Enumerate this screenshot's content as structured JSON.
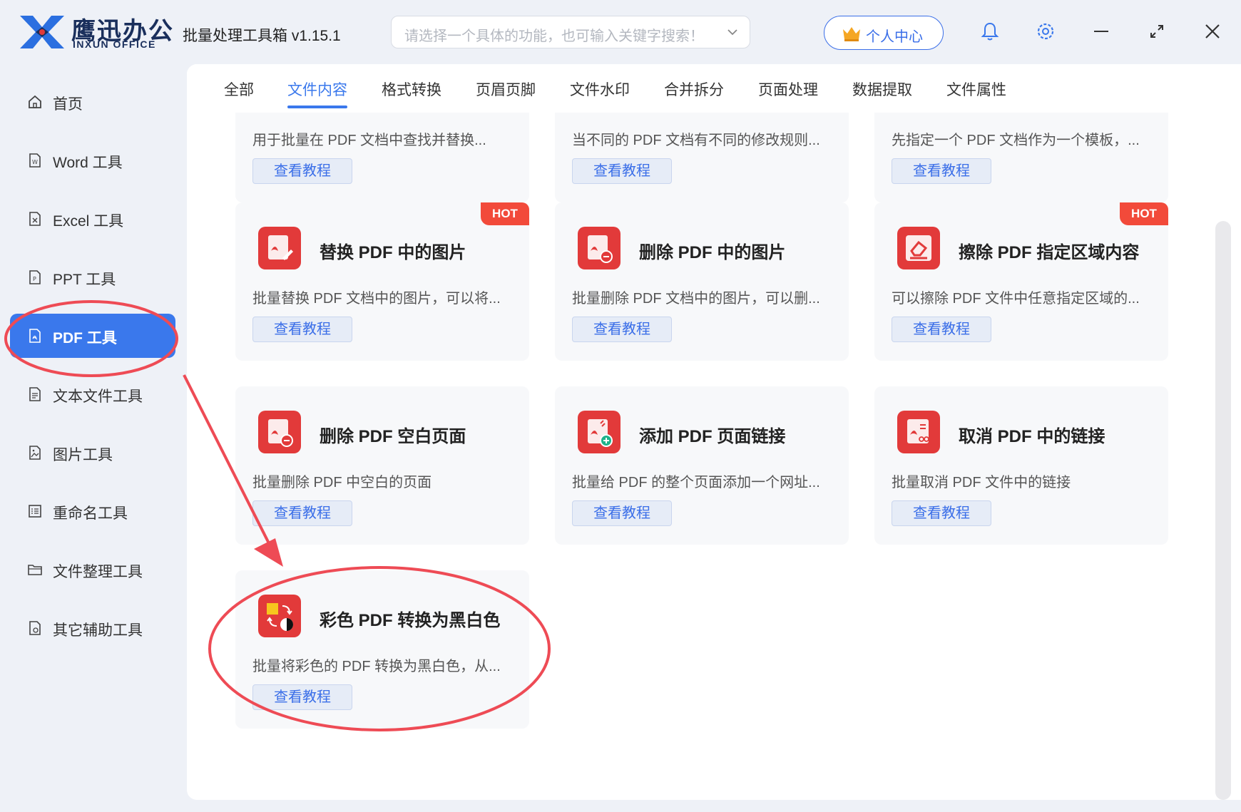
{
  "app": {
    "brand_cn": "鹰迅办公",
    "brand_en": "INXUN OFFICE",
    "title": "批量处理工具箱 v1.15.1"
  },
  "search": {
    "placeholder": "请选择一个具体的功能，也可输入关键字搜索！"
  },
  "header": {
    "user_label": "个人中心"
  },
  "sidebar": {
    "items": [
      {
        "label": "首页",
        "icon": "home-icon"
      },
      {
        "label": "Word 工具",
        "icon": "word-file-icon"
      },
      {
        "label": "Excel 工具",
        "icon": "excel-file-icon"
      },
      {
        "label": "PPT 工具",
        "icon": "ppt-file-icon"
      },
      {
        "label": "PDF 工具",
        "icon": "pdf-file-icon",
        "active": true
      },
      {
        "label": "文本文件工具",
        "icon": "text-file-icon"
      },
      {
        "label": "图片工具",
        "icon": "image-file-icon"
      },
      {
        "label": "重命名工具",
        "icon": "rename-icon"
      },
      {
        "label": "文件整理工具",
        "icon": "folder-icon"
      },
      {
        "label": "其它辅助工具",
        "icon": "utility-icon"
      }
    ]
  },
  "tabs": [
    {
      "label": "全部"
    },
    {
      "label": "文件内容",
      "active": true
    },
    {
      "label": "格式转换"
    },
    {
      "label": "页眉页脚"
    },
    {
      "label": "文件水印"
    },
    {
      "label": "合并拆分"
    },
    {
      "label": "页面处理"
    },
    {
      "label": "数据提取"
    },
    {
      "label": "文件属性"
    }
  ],
  "cards": {
    "partial": [
      {
        "desc": "用于批量在 PDF 文档中查找并替换...",
        "button": "查看教程"
      },
      {
        "desc": "当不同的 PDF 文档有不同的修改规则...",
        "button": "查看教程"
      },
      {
        "desc": "先指定一个 PDF 文档作为一个模板，...",
        "button": "查看教程"
      }
    ],
    "items": [
      {
        "title": "替换 PDF 中的图片",
        "desc": "批量替换 PDF 文档中的图片，可以将...",
        "button": "查看教程",
        "badge": "HOT",
        "icon": "replace-pdf-image-icon"
      },
      {
        "title": "删除 PDF 中的图片",
        "desc": "批量删除 PDF 文档中的图片，可以删...",
        "button": "查看教程",
        "badge": "",
        "icon": "delete-pdf-image-icon"
      },
      {
        "title": "擦除 PDF 指定区域内容",
        "desc": "可以擦除 PDF 文件中任意指定区域的...",
        "button": "查看教程",
        "badge": "HOT",
        "icon": "eraser-icon"
      },
      {
        "title": "删除 PDF 空白页面",
        "desc": "批量删除 PDF 中空白的页面",
        "button": "查看教程",
        "badge": "",
        "icon": "delete-blank-page-icon"
      },
      {
        "title": "添加 PDF 页面链接",
        "desc": "批量给 PDF 的整个页面添加一个网址...",
        "button": "查看教程",
        "badge": "",
        "icon": "add-link-icon"
      },
      {
        "title": "取消 PDF 中的链接",
        "desc": "批量取消 PDF 文件中的链接",
        "button": "查看教程",
        "badge": "",
        "icon": "remove-link-icon"
      },
      {
        "title": "彩色 PDF 转换为黑白色",
        "desc": "批量将彩色的 PDF 转换为黑白色，从...",
        "button": "查看教程",
        "badge": "",
        "icon": "color-to-bw-icon"
      }
    ]
  },
  "colors": {
    "accent": "#3a78ec",
    "hot": "#f24a3a",
    "icon_red": "#e23a3a",
    "annotation": "#ee4b55"
  }
}
